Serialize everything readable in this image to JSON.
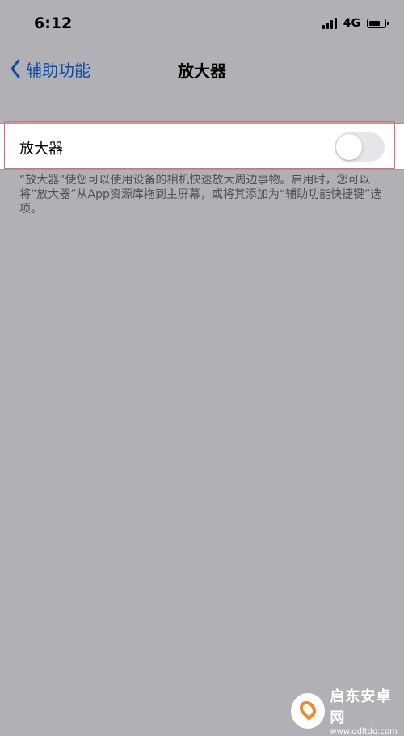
{
  "status_bar": {
    "time": "6:12",
    "network": "4G",
    "icons": [
      "cellular-signal-icon",
      "battery-icon"
    ]
  },
  "nav": {
    "back_label": "辅助功能",
    "title": "放大器",
    "accent_color": "#0c4ba8"
  },
  "setting": {
    "label": "放大器",
    "toggle_state": "off",
    "footer": "“放大器”使您可以使用设备的相机快速放大周边事物。启用时，您可以将“放大器”从App资源库拖到主屏幕，或将其添加为“辅助功能快捷键”选项。"
  },
  "watermark": {
    "name": "启东安卓网",
    "url": "www.qdltdq.com"
  }
}
